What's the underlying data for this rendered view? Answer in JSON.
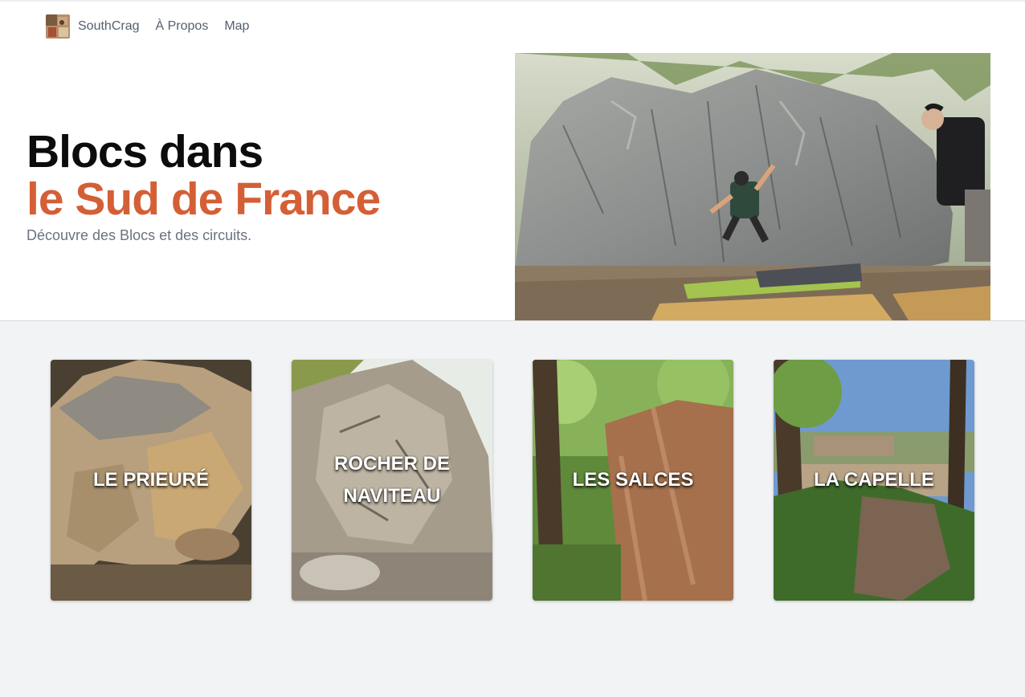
{
  "nav": {
    "brand": "SouthCrag",
    "links": [
      "À Propos",
      "Map"
    ]
  },
  "hero": {
    "title_line1": "Blocs dans",
    "title_line2": "le Sud de France",
    "subtitle": "Découvre des Blocs et des circuits."
  },
  "cards": [
    {
      "label": "LE PRIEURÉ"
    },
    {
      "label": "ROCHER DE NAVITEAU"
    },
    {
      "label": "LES SALCES"
    },
    {
      "label": "LA CAPELLE"
    }
  ],
  "colors": {
    "accent": "#d45f36",
    "title": "#0c0c0c",
    "muted": "#6b7280",
    "section_bg": "#f2f3f5"
  }
}
